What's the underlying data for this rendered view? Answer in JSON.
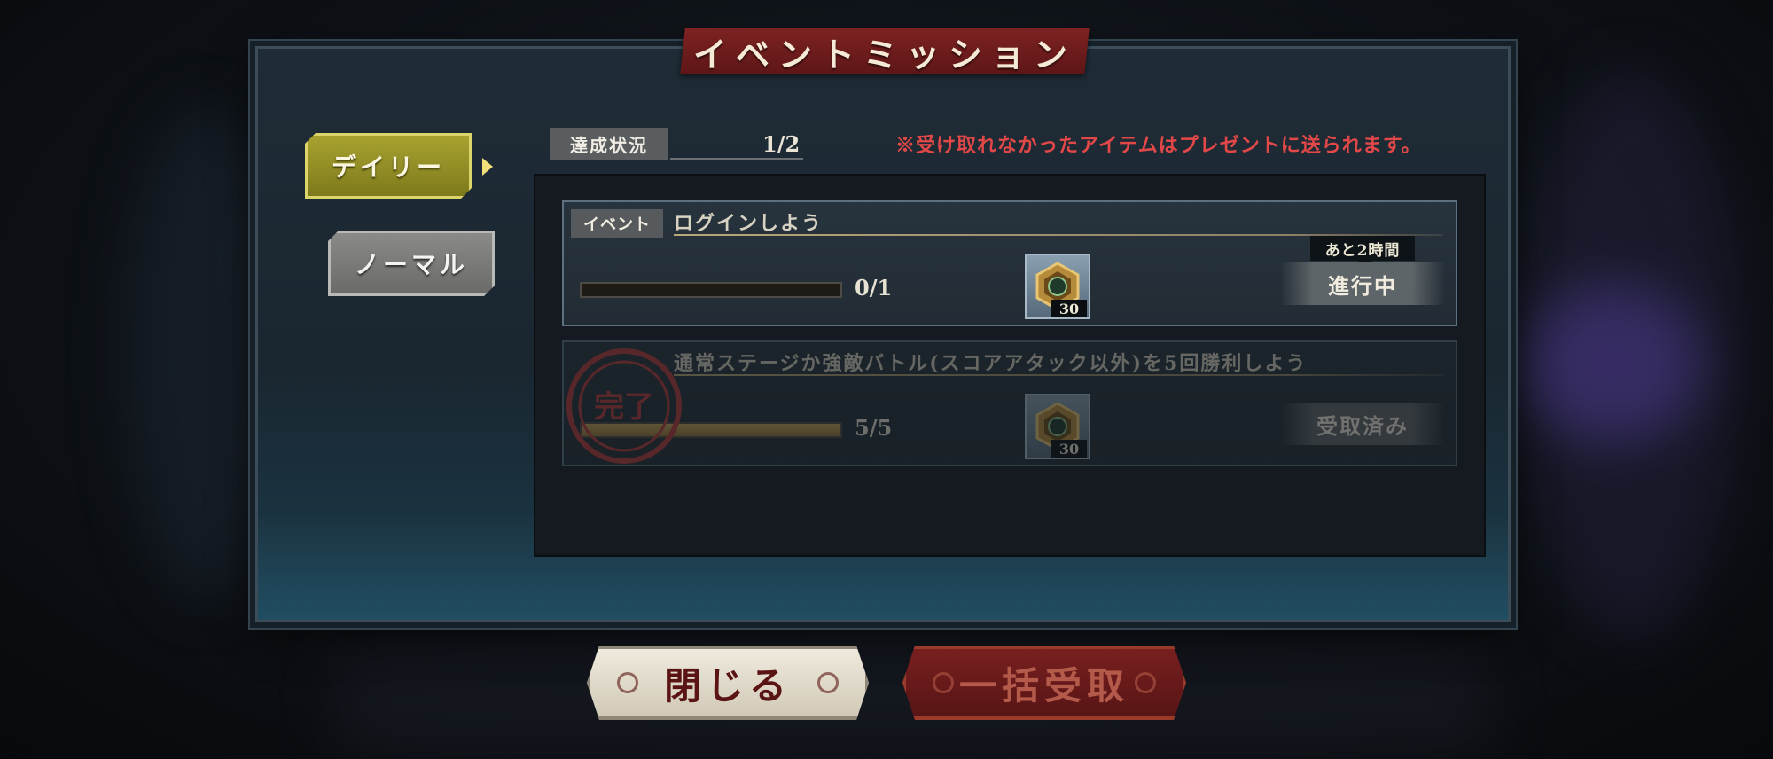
{
  "dialog": {
    "title": "イベントミッション",
    "tabs": [
      {
        "label": "デイリー",
        "selected": true
      },
      {
        "label": "ノーマル",
        "selected": false
      }
    ],
    "status": {
      "label": "達成状況",
      "value": "1/2"
    },
    "notice": "※受け取れなかったアイテムはプレゼントに送られます。",
    "missions": [
      {
        "category": "イベント",
        "name": "ログインしよう",
        "progress_text": "0/1",
        "progress_ratio": 0,
        "reward_qty": "30",
        "time_left": "あと2時間",
        "state": "進行中",
        "completed": false
      },
      {
        "category": "",
        "name": "通常ステージか強敵バトル(スコアアタック以外)を5回勝利しよう",
        "progress_text": "5/5",
        "progress_ratio": 1,
        "reward_qty": "30",
        "time_left": "",
        "state": "受取済み",
        "completed": true,
        "stamp_text": "完了"
      }
    ],
    "buttons": {
      "close": "閉じる",
      "claim_all": "一括受取"
    }
  },
  "colors": {
    "accent_red": "#e34848",
    "tab_active": "#a8a230",
    "progress_fill": "#c9a458"
  }
}
